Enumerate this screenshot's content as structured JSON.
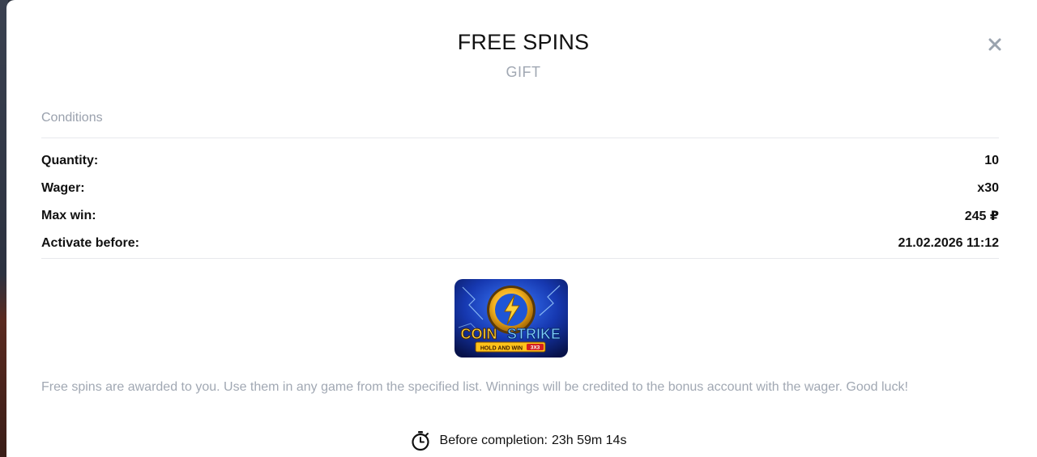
{
  "modal": {
    "title": "FREE SPINS",
    "subtitle": "GIFT",
    "close_icon": "close-icon"
  },
  "conditions": {
    "heading": "Conditions",
    "rows": [
      {
        "label": "Quantity:",
        "value": "10"
      },
      {
        "label": "Wager:",
        "value": "x30"
      },
      {
        "label": "Max win:",
        "value": "245 ₽"
      },
      {
        "label": "Activate before:",
        "value": "21.02.2026 11:12"
      }
    ]
  },
  "game": {
    "logo_main_left": "COIN",
    "logo_main_right": "STRIKE",
    "logo_sub": "HOLD AND WIN",
    "logo_badge": "3X3"
  },
  "description": "Free spins are awarded to you. Use them in any game from the specified list. Winnings will be credited to the bonus account with the wager. Good luck!",
  "timer": {
    "icon": "stopwatch-icon",
    "label": "Before completion:",
    "value": "23h 59m 14s"
  },
  "colors": {
    "title": "#111111",
    "muted": "#a1a8b3",
    "divider": "#e7e9ed",
    "game_bg": "#0f2d8a",
    "coin": "#f2b01e"
  }
}
